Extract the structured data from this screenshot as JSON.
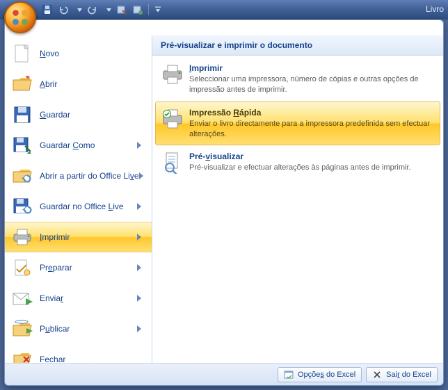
{
  "titlebar": {
    "title": "Livro"
  },
  "left_menu": {
    "items": [
      {
        "label_pre": "",
        "accel": "N",
        "label_post": "ovo",
        "has_arrow": false
      },
      {
        "label_pre": "",
        "accel": "A",
        "label_post": "brir",
        "has_arrow": false
      },
      {
        "label_pre": "",
        "accel": "G",
        "label_post": "uardar",
        "has_arrow": false
      },
      {
        "label_pre": "Guardar ",
        "accel": "C",
        "label_post": "omo",
        "has_arrow": true
      },
      {
        "label_pre": "Abrir a partir do Office Li",
        "accel": "v",
        "label_post": "e",
        "has_arrow": true
      },
      {
        "label_pre": "Guardar no Office ",
        "accel": "L",
        "label_post": "ive",
        "has_arrow": true
      },
      {
        "label_pre": "",
        "accel": "I",
        "label_post": "mprimir",
        "has_arrow": true
      },
      {
        "label_pre": "Pr",
        "accel": "e",
        "label_post": "parar",
        "has_arrow": true
      },
      {
        "label_pre": "Envia",
        "accel": "r",
        "label_post": "",
        "has_arrow": true
      },
      {
        "label_pre": "P",
        "accel": "u",
        "label_post": "blicar",
        "has_arrow": true
      },
      {
        "label_pre": "",
        "accel": "F",
        "label_post": "echar",
        "has_arrow": false
      }
    ],
    "selected_index": 6
  },
  "right_panel": {
    "header": "Pré-visualizar e imprimir o documento",
    "options": [
      {
        "title_pre": "",
        "accel": "I",
        "title_post": "mprimir",
        "desc": "Seleccionar uma impressora, número de cópias e outras opções de impressão antes de imprimir."
      },
      {
        "title_pre": "Impressão ",
        "accel": "R",
        "title_post": "ápida",
        "desc": "Enviar o livro directamente para a impressora predefinida sem efectuar alterações."
      },
      {
        "title_pre": "Pré-",
        "accel": "v",
        "title_post": "isualizar",
        "desc": "Pré-visualizar e efectuar alterações às páginas antes de imprimir."
      }
    ],
    "hovered_index": 1
  },
  "footer": {
    "options_label_pre": "Opçõe",
    "options_accel": "s",
    "options_label_post": " do Excel",
    "exit_label_pre": "Sai",
    "exit_accel": "r",
    "exit_label_post": " do Excel"
  }
}
